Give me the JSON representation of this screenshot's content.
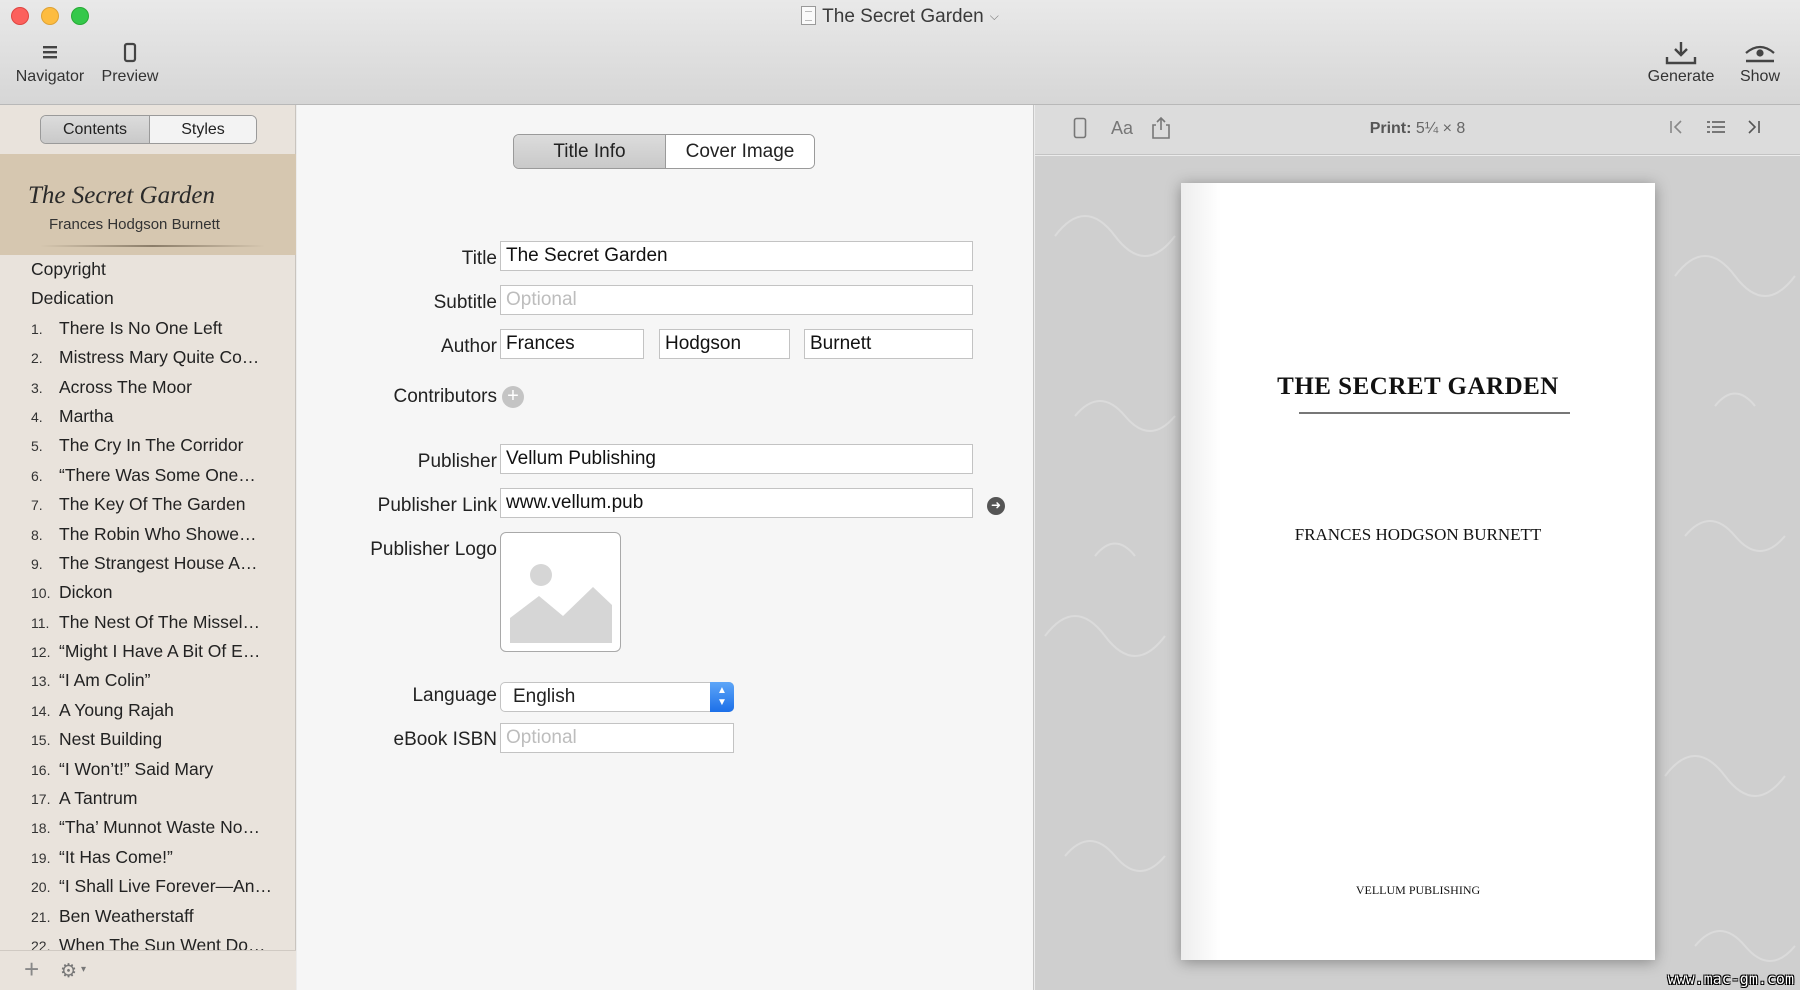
{
  "window": {
    "title": "The Secret Garden"
  },
  "toolbar": {
    "navigator_label": "Navigator",
    "preview_label": "Preview",
    "generate_label": "Generate",
    "show_label": "Show"
  },
  "sidebar": {
    "tabs": [
      "Contents",
      "Styles"
    ],
    "active_tab": "Contents",
    "book_title": "The Secret Garden",
    "book_author": "Frances Hodgson Burnett",
    "items": [
      {
        "num": "",
        "label": "Copyright"
      },
      {
        "num": "",
        "label": "Dedication"
      },
      {
        "num": "1.",
        "label": "There Is No One Left"
      },
      {
        "num": "2.",
        "label": "Mistress Mary Quite Co…"
      },
      {
        "num": "3.",
        "label": "Across The Moor"
      },
      {
        "num": "4.",
        "label": "Martha"
      },
      {
        "num": "5.",
        "label": "The Cry In The Corridor"
      },
      {
        "num": "6.",
        "label": "“There Was Some One…"
      },
      {
        "num": "7.",
        "label": "The Key Of The Garden"
      },
      {
        "num": "8.",
        "label": "The Robin Who Showe…"
      },
      {
        "num": "9.",
        "label": "The Strangest House A…"
      },
      {
        "num": "10.",
        "label": "Dickon"
      },
      {
        "num": "11.",
        "label": "The Nest Of The Missel…"
      },
      {
        "num": "12.",
        "label": "“Might I Have A Bit Of E…"
      },
      {
        "num": "13.",
        "label": "“I Am Colin”"
      },
      {
        "num": "14.",
        "label": "A Young Rajah"
      },
      {
        "num": "15.",
        "label": "Nest Building"
      },
      {
        "num": "16.",
        "label": "“I Won’t!” Said Mary"
      },
      {
        "num": "17.",
        "label": "A Tantrum"
      },
      {
        "num": "18.",
        "label": "“Tha’ Munnot Waste No…"
      },
      {
        "num": "19.",
        "label": "“It Has Come!”"
      },
      {
        "num": "20.",
        "label": "“I Shall Live Forever—An…"
      },
      {
        "num": "21.",
        "label": "Ben Weatherstaff"
      },
      {
        "num": "22.",
        "label": "When The Sun Went Do…"
      }
    ]
  },
  "form": {
    "tabs": [
      "Title Info",
      "Cover Image"
    ],
    "active_tab": "Title Info",
    "title_label": "Title",
    "title_value": "The Secret Garden",
    "subtitle_label": "Subtitle",
    "subtitle_placeholder": "Optional",
    "author_label": "Author",
    "author_first": "Frances",
    "author_middle": "Hodgson",
    "author_last": "Burnett",
    "contributors_label": "Contributors",
    "publisher_label": "Publisher",
    "publisher_value": "Vellum Publishing",
    "publisher_link_label": "Publisher Link",
    "publisher_link_value": "www.vellum.pub",
    "publisher_logo_label": "Publisher Logo",
    "language_label": "Language",
    "language_value": "English",
    "isbn_label": "eBook ISBN",
    "isbn_placeholder": "Optional"
  },
  "preview": {
    "print_label": "Print:",
    "print_size": "5¼ × 8",
    "page_title": "THE SECRET GARDEN",
    "page_author": "FRANCES HODGSON BURNETT",
    "page_publisher": "VELLUM PUBLISHING"
  },
  "watermark": "www.mac-gm.com"
}
